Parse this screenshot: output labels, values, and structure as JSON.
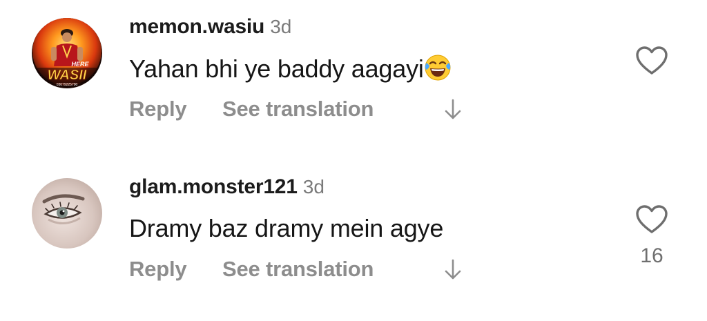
{
  "comments": [
    {
      "username": "memon.wasiu",
      "timestamp": "3d",
      "text": "Yahan bhi ye baddy aagayi",
      "emoji": "face-with-tears-of-joy",
      "reply_label": "Reply",
      "translate_label": "See translation",
      "avatar_text": "WASII",
      "avatar_tag": "HERE",
      "avatar_number": "03079225790",
      "like_count": ""
    },
    {
      "username": "glam.monster121",
      "timestamp": "3d",
      "text": "Dramy baz dramy mein agye",
      "reply_label": "Reply",
      "translate_label": "See translation",
      "like_count": "16"
    }
  ],
  "icons": {
    "like": "heart-outline-icon",
    "view_replies": "arrow-down-icon"
  },
  "colors": {
    "background": "#ffffff",
    "username": "#1c1c1c",
    "muted": "#8d8d8d",
    "timestamp": "#7a7a7a",
    "icon_stroke": "#6e6e6e"
  }
}
